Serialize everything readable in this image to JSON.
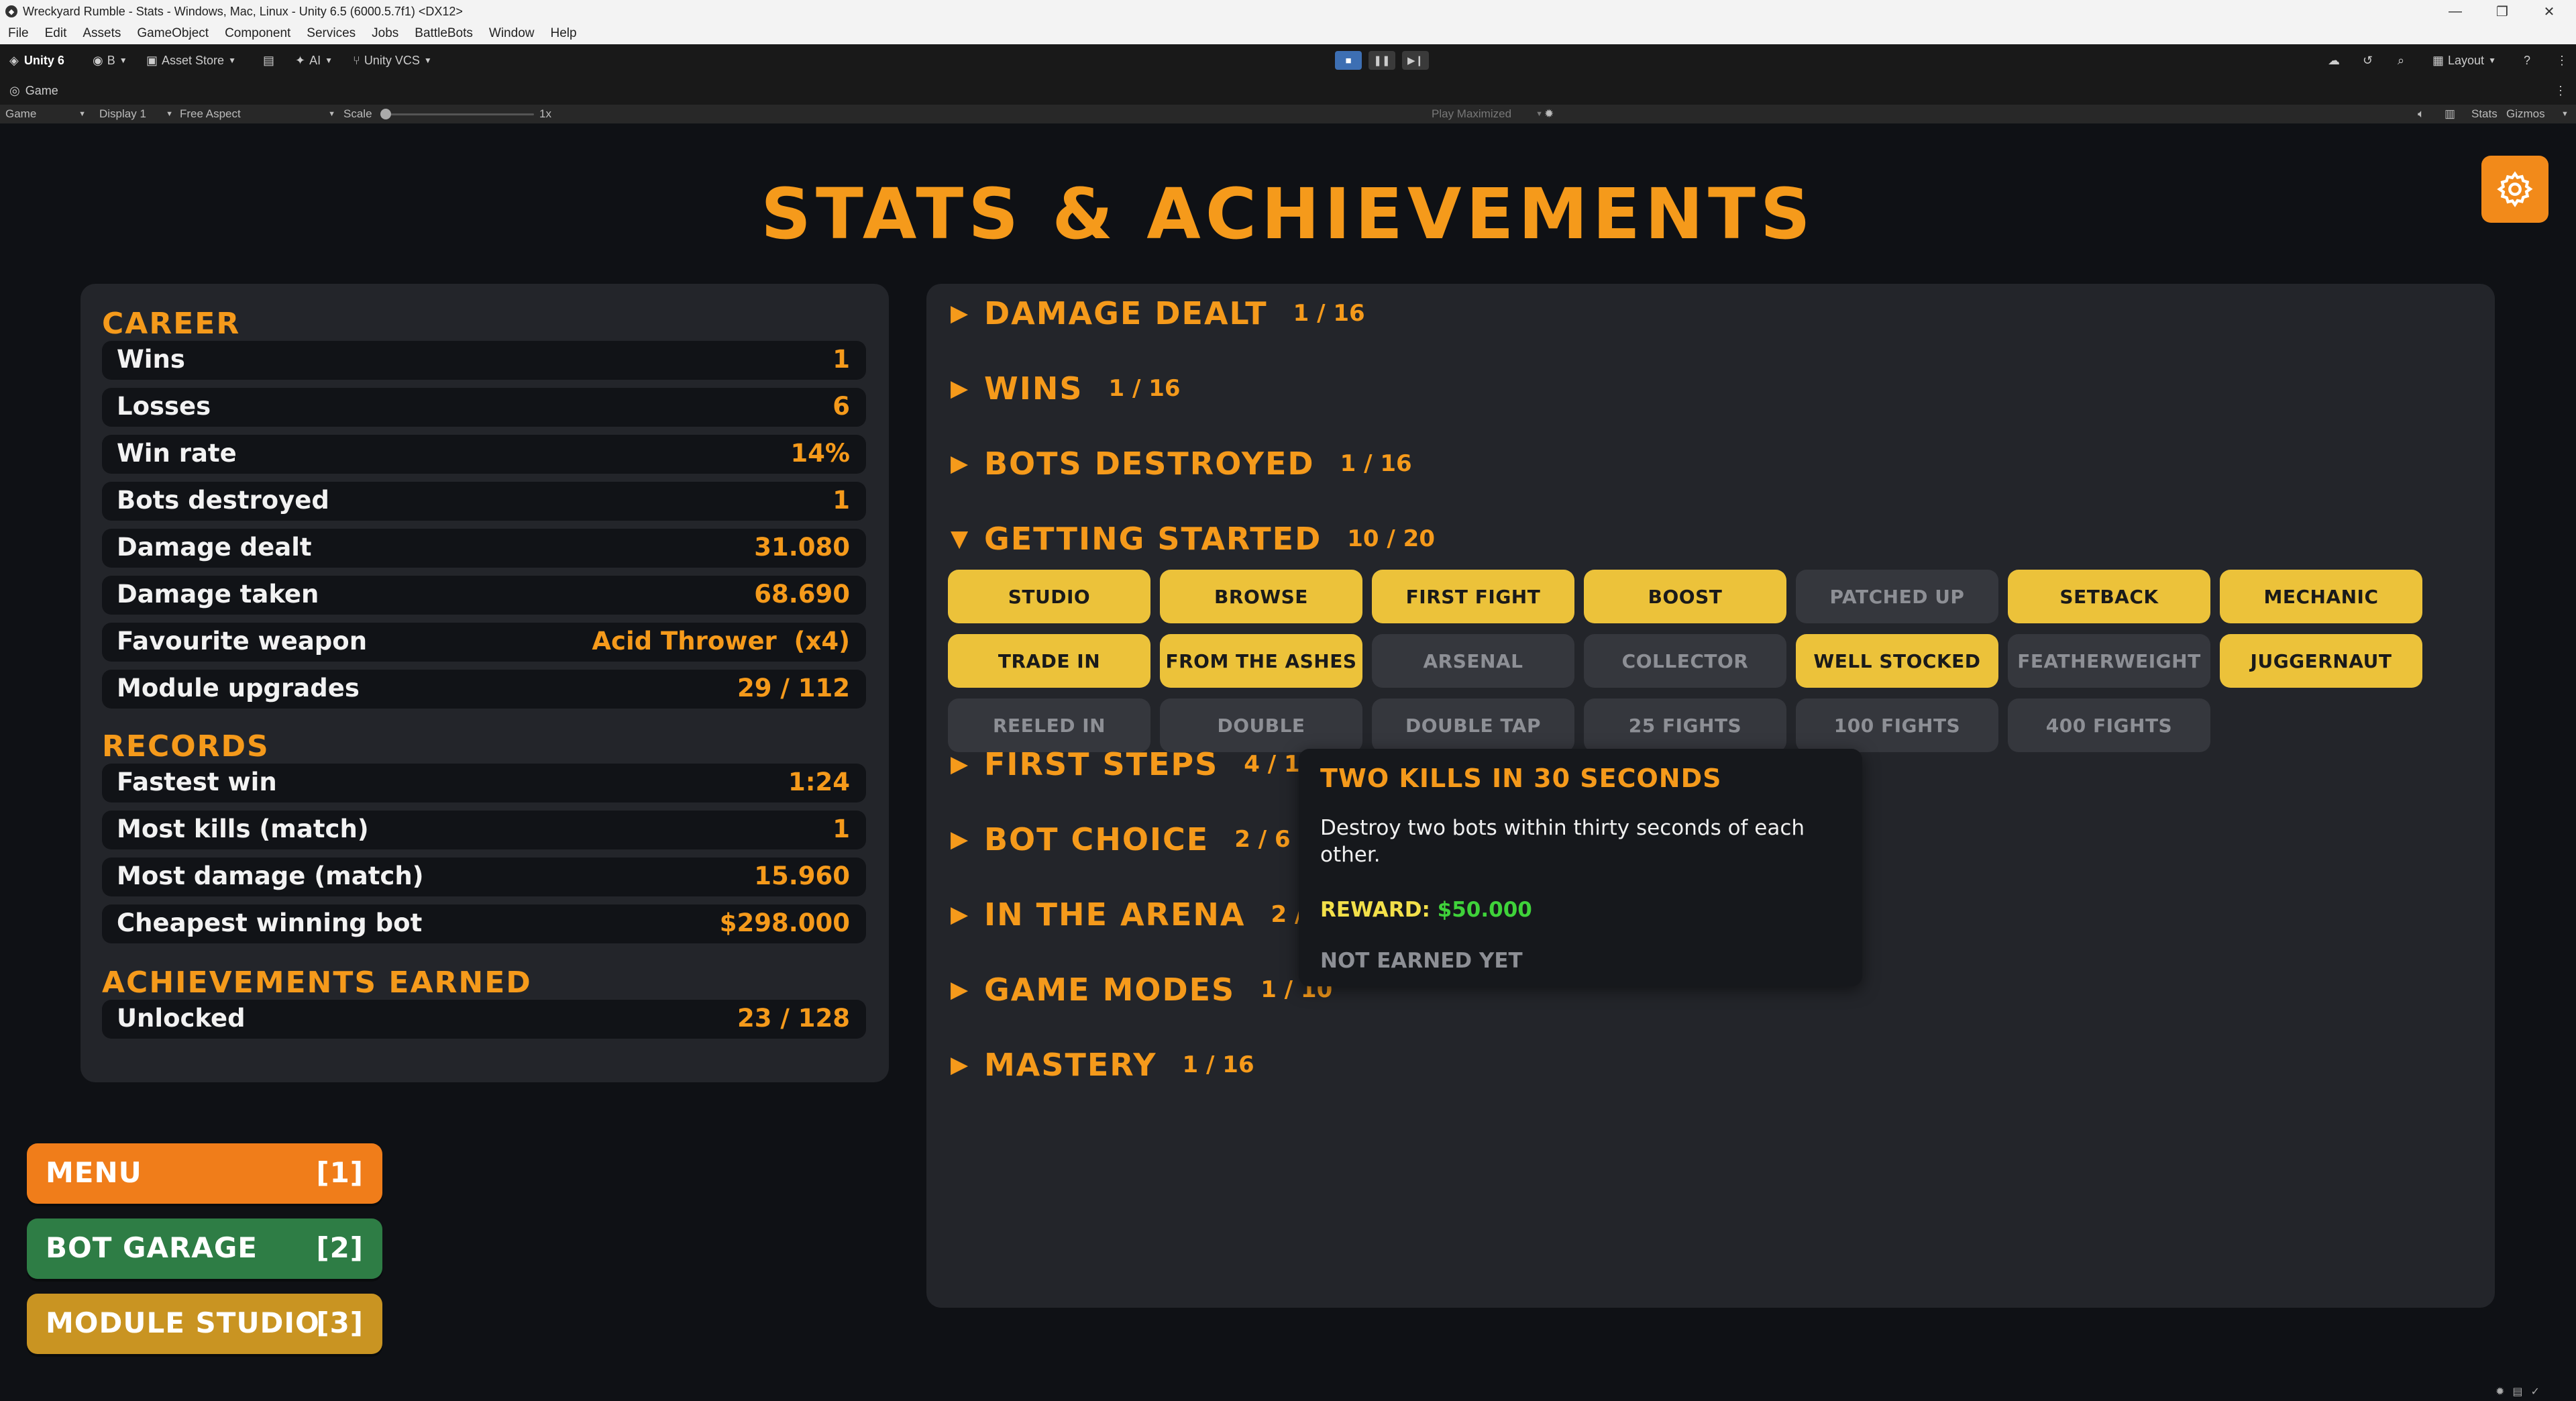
{
  "window": {
    "title": "Wreckyard Rumble - Stats - Windows, Mac, Linux - Unity 6.5 (6000.5.7f1) <DX12>",
    "controls": {
      "minimize": "—",
      "maximize": "❐",
      "close": "✕"
    }
  },
  "menubar": [
    "File",
    "Edit",
    "Assets",
    "GameObject",
    "Component",
    "Services",
    "Jobs",
    "BattleBots",
    "Window",
    "Help"
  ],
  "toolbar": {
    "unity_label": "Unity 6",
    "account_label": "B",
    "asset_store": "Asset Store",
    "ai": "AI",
    "vcs": "Unity VCS",
    "layout": "Layout"
  },
  "game_tab": {
    "label": "Game"
  },
  "game_bar": {
    "mode": "Game",
    "display": "Display 1",
    "aspect": "Free Aspect",
    "scale_label": "Scale",
    "scale_value": "1x",
    "play_mode": "Play Maximized",
    "stats": "Stats",
    "gizmos": "Gizmos"
  },
  "page": {
    "title": "STATS & ACHIEVEMENTS"
  },
  "career": {
    "title": "CAREER",
    "rows": [
      {
        "label": "Wins",
        "value": "1"
      },
      {
        "label": "Losses",
        "value": "6"
      },
      {
        "label": "Win rate",
        "value": "14%"
      },
      {
        "label": "Bots destroyed",
        "value": "1"
      },
      {
        "label": "Damage dealt",
        "value": "31.080"
      },
      {
        "label": "Damage taken",
        "value": "68.690"
      },
      {
        "label": "Favourite weapon",
        "value": "Acid Thrower  (x4)"
      },
      {
        "label": "Module upgrades",
        "value": "29 / 112"
      }
    ]
  },
  "records": {
    "title": "RECORDS",
    "rows": [
      {
        "label": "Fastest win",
        "value": "1:24"
      },
      {
        "label": "Most kills (match)",
        "value": "1"
      },
      {
        "label": "Most damage (match)",
        "value": "15.960"
      },
      {
        "label": "Cheapest winning bot",
        "value": "$298.000"
      }
    ]
  },
  "achievements_earned": {
    "title": "ACHIEVEMENTS EARNED",
    "rows": [
      {
        "label": "Unlocked",
        "value": "23 / 128"
      }
    ]
  },
  "categories": [
    {
      "name": "DAMAGE DEALT",
      "count": "1 / 16",
      "arrow": "▶"
    },
    {
      "name": "WINS",
      "count": "1 / 16",
      "arrow": "▶"
    },
    {
      "name": "BOTS DESTROYED",
      "count": "1 / 16",
      "arrow": "▶"
    },
    {
      "name": "GETTING STARTED",
      "count": "10 / 20",
      "arrow": "▼"
    },
    {
      "name": "FIRST STEPS",
      "count": "4 / 12",
      "arrow": "▶"
    },
    {
      "name": "BOT CHOICE",
      "count": "2 / 6",
      "arrow": "▶"
    },
    {
      "name": "IN THE ARENA",
      "count": "2 / 16",
      "arrow": "▶"
    },
    {
      "name": "GAME MODES",
      "count": "1 / 10",
      "arrow": "▶"
    },
    {
      "name": "MASTERY",
      "count": "1 / 16",
      "arrow": "▶"
    }
  ],
  "getting_started_achievements": [
    {
      "label": "STUDIO",
      "earned": true
    },
    {
      "label": "BROWSE",
      "earned": true
    },
    {
      "label": "FIRST FIGHT",
      "earned": true
    },
    {
      "label": "BOOST",
      "earned": true
    },
    {
      "label": "PATCHED UP",
      "earned": false
    },
    {
      "label": "SETBACK",
      "earned": true
    },
    {
      "label": "MECHANIC",
      "earned": true
    },
    {
      "label": "TRADE IN",
      "earned": true
    },
    {
      "label": "FROM THE ASHES",
      "earned": true
    },
    {
      "label": "ARSENAL",
      "earned": false
    },
    {
      "label": "COLLECTOR",
      "earned": false
    },
    {
      "label": "WELL STOCKED",
      "earned": true
    },
    {
      "label": "FEATHERWEIGHT",
      "earned": false
    },
    {
      "label": "JUGGERNAUT",
      "earned": true
    },
    {
      "label": "REELED IN",
      "earned": false
    },
    {
      "label": "DOUBLE",
      "earned": false
    },
    {
      "label": "DOUBLE TAP",
      "earned": false
    },
    {
      "label": "25 FIGHTS",
      "earned": false
    },
    {
      "label": "100 FIGHTS",
      "earned": false
    },
    {
      "label": "400 FIGHTS",
      "earned": false
    }
  ],
  "tooltip": {
    "title": "TWO KILLS IN 30 SECONDS",
    "description": "Destroy two bots within thirty seconds of each other.",
    "reward_label": "REWARD:",
    "reward_value": "$50.000",
    "status": "NOT EARNED YET"
  },
  "nav": [
    {
      "label": "MENU",
      "key": "[1]",
      "color": "#f07d1a"
    },
    {
      "label": "BOT GARAGE",
      "key": "[2]",
      "color": "#2e7d45"
    },
    {
      "label": "MODULE STUDIO",
      "key": "[3]",
      "color": "#c99422"
    }
  ],
  "colors": {
    "accent_orange": "#f59a1b",
    "earned_yellow": "#ecc23a",
    "locked_gray": "#35373d",
    "reward_label": "#f3e04a",
    "reward_value": "#3fd23a"
  }
}
